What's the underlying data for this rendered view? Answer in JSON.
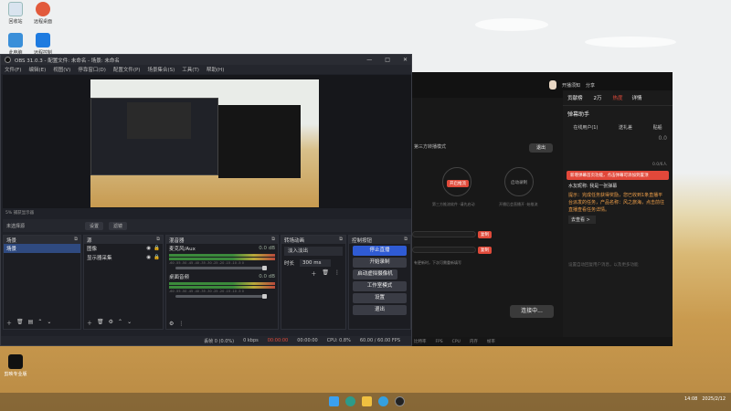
{
  "desktop": {
    "icons": [
      {
        "label": "回收站"
      },
      {
        "label": "远程桌面"
      },
      {
        "label": "此电脑"
      },
      {
        "label": "远程控制"
      },
      {
        "label": "剪映专业版"
      }
    ]
  },
  "obs": {
    "title": "OBS 31.0.3 - 配置文件: 未命名 - 场景: 未命名",
    "menu": [
      "文件(F)",
      "编辑(E)",
      "视图(V)",
      "停靠窗口(D)",
      "配置文件(P)",
      "场景集合(S)",
      "工具(T)",
      "帮助(H)"
    ],
    "status_line": "5%  捕获显示器",
    "source_bar": {
      "label": "未选择源",
      "settings": "设置",
      "filters": "滤镜"
    },
    "scenes": {
      "title": "场景",
      "items": [
        "场景"
      ]
    },
    "sources": {
      "title": "源",
      "items": [
        "图像",
        "显示器采集"
      ]
    },
    "mixer": {
      "title": "混音器",
      "tracks": [
        {
          "name": "麦克风/Aux",
          "db": "0.0 dB"
        },
        {
          "name": "桌面音频",
          "db": "0.0 dB"
        }
      ],
      "scale": "-60 -55 -50 -45 -40 -35 -30 -25 -20 -15 -10 -5 0"
    },
    "transitions": {
      "title": "转场动画",
      "type": "淡入淡出",
      "duration_label": "时长",
      "duration": "300 ms"
    },
    "controls": {
      "title": "控制按钮",
      "buttons": [
        "停止直播",
        "开始录制",
        "启动虚拟摄像机",
        "工作室模式",
        "设置",
        "退出"
      ]
    },
    "status": {
      "dropped": "丢帧 0 (0.0%)",
      "kbps": "0 kbps",
      "live_time": "00:00:00",
      "rec_time": "00:00:00",
      "cpu": "CPU: 0.8%",
      "fps": "60.00 / 60.00 FPS"
    }
  },
  "app": {
    "top": {
      "live_label": "开播须知",
      "share": "分享"
    },
    "side_tabs": {
      "gift": "贡献榜",
      "count": "2万",
      "hot": "热度",
      "detail": "详情"
    },
    "assistant": {
      "title": "弹幕助手",
      "tabs": [
        "在线用户(1)",
        "送礼差",
        "贴船"
      ],
      "warning": "新增弹幕首页功能，点击弹幕可添加到置顶",
      "tag": "水友昵称: 我是一张弹幕",
      "task_text": "提示：完成任务获得奖励，您已收到1条直播平台派发的任务，产品名称：风之旅海，点击前往直播查看任务详情。",
      "task_link": "去查看 >",
      "more_info": "设置自动回复用户消息，以及更多功能",
      "count": "0.0",
      "ratio": "0.0/6人"
    },
    "mid": {
      "heading": "第三方转播模式",
      "exit": "退出",
      "node1": "开启推流",
      "node2": "启动录制",
      "node_desc1": "第三方推流软件 ·请先启动",
      "node_desc2": "开播后会直播开 ·始推流",
      "copy": "复制",
      "hint": "有更新时，下次可需重新填写",
      "start": "连接中..."
    },
    "status": [
      "比特率",
      "FPS",
      "CPU",
      "内存",
      "帧率"
    ]
  },
  "taskbar": {
    "clock": "14:08",
    "date": "2025/2/12"
  },
  "colors": {
    "obs_bg": "#1f2128",
    "obs_primary": "#2f5bd4",
    "app_red": "#e04a3a",
    "note_orange": "#f0a04a"
  }
}
